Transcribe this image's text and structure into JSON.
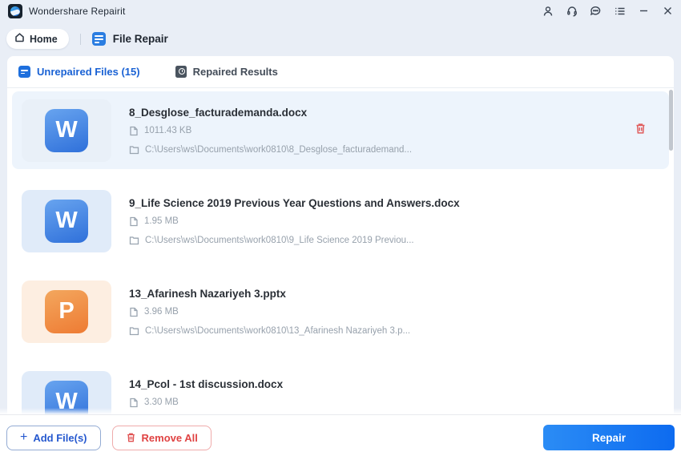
{
  "titlebar": {
    "app_title": "Wondershare Repairit",
    "icons": [
      "account-icon",
      "support-headset-icon",
      "feedback-icon",
      "menu-list-icon",
      "minimize-icon",
      "close-icon"
    ]
  },
  "tabbar": {
    "home_label": "Home",
    "file_repair_label": "File Repair"
  },
  "list_tabs": {
    "unrepaired_label": "Unrepaired Files (15)",
    "repaired_label": "Repaired Results"
  },
  "files": [
    {
      "name": "8_Desglose_facturademanda.docx",
      "size": "1011.43 KB",
      "path": "C:\\Users\\ws\\Documents\\work0810\\8_Desglose_facturademand...",
      "kind": "word",
      "letter": "W",
      "selected": true
    },
    {
      "name": "9_Life Science 2019 Previous Year Questions and Answers.docx",
      "size": "1.95 MB",
      "path": "C:\\Users\\ws\\Documents\\work0810\\9_Life Science 2019 Previou...",
      "kind": "word",
      "letter": "W",
      "selected": false
    },
    {
      "name": "13_Afarinesh Nazariyeh 3.pptx",
      "size": "3.96 MB",
      "path": "C:\\Users\\ws\\Documents\\work0810\\13_Afarinesh Nazariyeh 3.p...",
      "kind": "ppt",
      "letter": "P",
      "selected": false
    },
    {
      "name": "14_Pcol - 1st discussion.docx",
      "size": "3.30 MB",
      "path": "",
      "kind": "word",
      "letter": "W",
      "selected": false
    }
  ],
  "footer": {
    "add_label": "Add File(s)",
    "remove_label": "Remove All",
    "repair_label": "Repair"
  },
  "colors": {
    "accent_blue": "#1a62d4",
    "repair_gradient_start": "#2b8cf5",
    "repair_gradient_end": "#0d6bf0",
    "danger_red": "#e04343",
    "selected_row_bg": "#edf4fc",
    "page_bg": "#e9eef6"
  }
}
